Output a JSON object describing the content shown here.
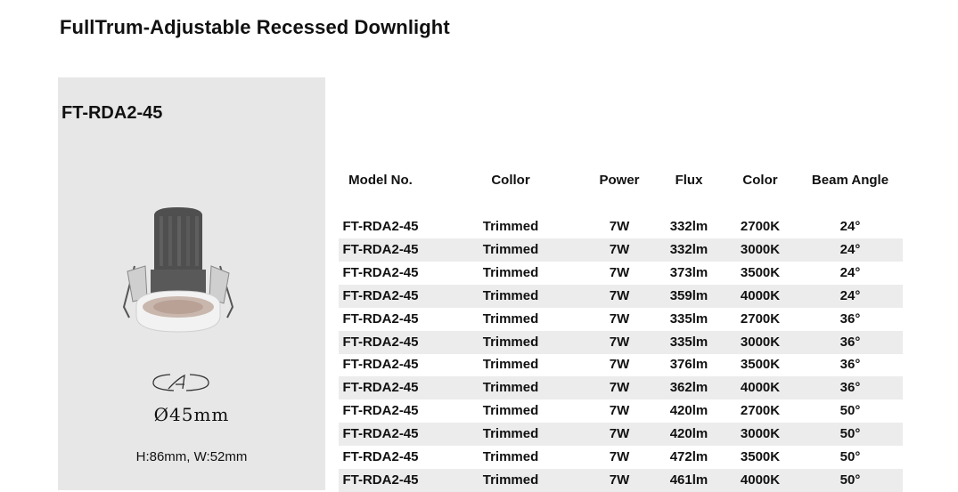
{
  "page": {
    "title": "FullTrum-Adjustable Recessed Downlight",
    "model_heading": "FT-RDA2-45",
    "cutout": "Ø45mm",
    "dimensions": "H:86mm, W:52mm",
    "image_icon": "downlight-product-image",
    "cutout_icon": "cutout-diameter-icon"
  },
  "table": {
    "headers": [
      "Model No.",
      "Collor",
      "Power",
      "Flux",
      "Color",
      "Beam Angle"
    ],
    "rows": [
      [
        "FT-RDA2-45",
        "Trimmed",
        "7W",
        "332lm",
        "2700K",
        "24°"
      ],
      [
        "FT-RDA2-45",
        "Trimmed",
        "7W",
        "332lm",
        "3000K",
        "24°"
      ],
      [
        "FT-RDA2-45",
        "Trimmed",
        "7W",
        "373lm",
        "3500K",
        "24°"
      ],
      [
        "FT-RDA2-45",
        "Trimmed",
        "7W",
        "359lm",
        "4000K",
        "24°"
      ],
      [
        "FT-RDA2-45",
        "Trimmed",
        "7W",
        "335lm",
        "2700K",
        "36°"
      ],
      [
        "FT-RDA2-45",
        "Trimmed",
        "7W",
        "335lm",
        "3000K",
        "36°"
      ],
      [
        "FT-RDA2-45",
        "Trimmed",
        "7W",
        "376lm",
        "3500K",
        "36°"
      ],
      [
        "FT-RDA2-45",
        "Trimmed",
        "7W",
        "362lm",
        "4000K",
        "36°"
      ],
      [
        "FT-RDA2-45",
        "Trimmed",
        "7W",
        "420lm",
        "2700K",
        "50°"
      ],
      [
        "FT-RDA2-45",
        "Trimmed",
        "7W",
        "420lm",
        "3000K",
        "50°"
      ],
      [
        "FT-RDA2-45",
        "Trimmed",
        "7W",
        "472lm",
        "3500K",
        "50°"
      ],
      [
        "FT-RDA2-45",
        "Trimmed",
        "7W",
        "461lm",
        "4000K",
        "50°"
      ]
    ],
    "shade_color": "#ececec",
    "panel_color": "#e7e7e7"
  }
}
